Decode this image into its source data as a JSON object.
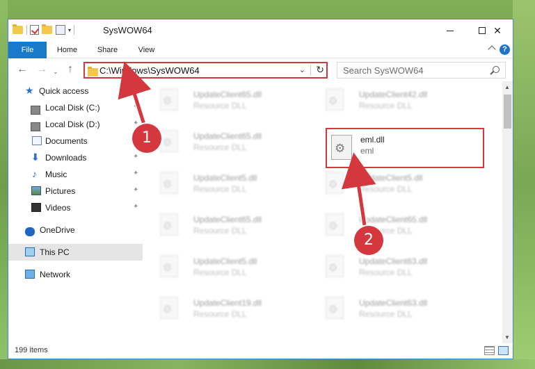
{
  "window": {
    "title": "SysWOW64",
    "minimize_symbol": "",
    "close_symbol": "✕"
  },
  "ribbon": {
    "tabs": [
      {
        "label": "File"
      },
      {
        "label": "Home"
      },
      {
        "label": "Share"
      },
      {
        "label": "View"
      }
    ],
    "help_symbol": "?"
  },
  "nav": {
    "back_symbol": "←",
    "forward_symbol": "→",
    "up_symbol": "↑",
    "address": "C:\\Windows\\SysWOW64",
    "address_caret": "⌄",
    "refresh_symbol": "↻",
    "search_placeholder": "Search SysWOW64"
  },
  "sidebar": {
    "items": [
      {
        "label": "Quick access",
        "icon": "star-icon"
      },
      {
        "label": "Local Disk (C:)",
        "icon": "disk-icon",
        "pinned": true
      },
      {
        "label": "Local Disk (D:)",
        "icon": "disk-icon",
        "pinned": true
      },
      {
        "label": "Documents",
        "icon": "documents-icon",
        "pinned": true
      },
      {
        "label": "Downloads",
        "icon": "downloads-icon",
        "pinned": true
      },
      {
        "label": "Music",
        "icon": "music-icon",
        "pinned": true
      },
      {
        "label": "Pictures",
        "icon": "pictures-icon",
        "pinned": true
      },
      {
        "label": "Videos",
        "icon": "videos-icon",
        "pinned": true
      },
      {
        "label": "OneDrive",
        "icon": "onedrive-icon"
      },
      {
        "label": "This PC",
        "icon": "this-pc-icon",
        "selected": true
      },
      {
        "label": "Network",
        "icon": "network-icon"
      }
    ],
    "pin_symbol": "✦"
  },
  "files": {
    "left_column": [
      {
        "name": "UpdateClient65.dll",
        "type": "Resource DLL"
      },
      {
        "name": "UpdateClient65.dll",
        "type": "Resource DLL"
      },
      {
        "name": "UpdateClient5.dll",
        "type": "Resource DLL"
      },
      {
        "name": "UpdateClient65.dll",
        "type": "Resource DLL"
      },
      {
        "name": "UpdateClient5.dll",
        "type": "Resource DLL"
      },
      {
        "name": "UpdateClient19.dll",
        "type": "Resource DLL"
      }
    ],
    "right_column": [
      {
        "name": "UpdateClient42.dll",
        "type": "Resource DLL"
      },
      {
        "name": "eml.dll",
        "type": "eml",
        "highlighted": true
      },
      {
        "name": "UpdateClient5.dll",
        "type": "Resource DLL"
      },
      {
        "name": "UpdateClient65.dll",
        "type": "Resource DLL"
      },
      {
        "name": "UpdateClient63.dll",
        "type": "Resource DLL"
      },
      {
        "name": "UpdateClient63.dll",
        "type": "Resource DLL"
      }
    ]
  },
  "status": {
    "item_count": "199 items"
  },
  "callouts": [
    {
      "number": "1"
    },
    {
      "number": "2"
    }
  ],
  "colors": {
    "accent": "#1979ca",
    "callout_red": "#d4383e"
  }
}
